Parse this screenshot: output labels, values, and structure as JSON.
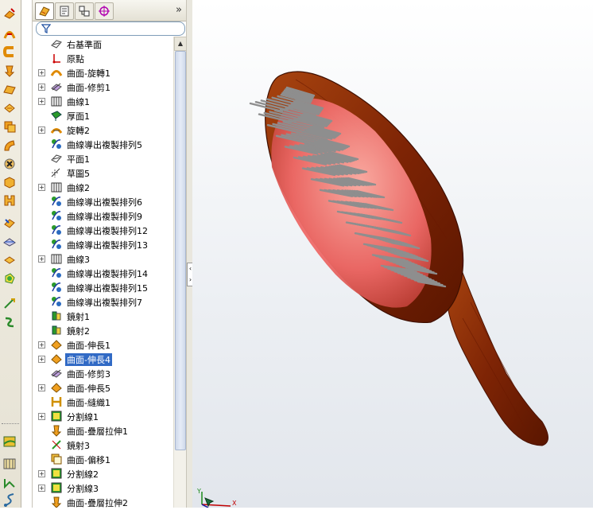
{
  "tabs": [
    {
      "icon": "feature-manager-icon",
      "active": true
    },
    {
      "icon": "property-manager-icon",
      "active": false
    },
    {
      "icon": "configuration-manager-icon",
      "active": false
    },
    {
      "icon": "dimxpert-icon",
      "active": false
    }
  ],
  "collapse_label": "»",
  "tree": [
    {
      "label": "右基準面",
      "icon": "plane-icon",
      "expandable": false
    },
    {
      "label": "原點",
      "icon": "origin-icon",
      "expandable": false
    },
    {
      "label": "曲面-旋轉1",
      "icon": "revolve-surface-icon",
      "expandable": true
    },
    {
      "label": "曲面-修剪1",
      "icon": "trim-surface-icon",
      "expandable": true
    },
    {
      "label": "曲線1",
      "icon": "curve-icon",
      "expandable": true
    },
    {
      "label": "厚面1",
      "icon": "thicken-icon",
      "expandable": false
    },
    {
      "label": "旋轉2",
      "icon": "revolve-icon",
      "expandable": true
    },
    {
      "label": "曲線導出複製排列5",
      "icon": "pattern-icon",
      "expandable": false
    },
    {
      "label": "平面1",
      "icon": "plane-icon",
      "expandable": false
    },
    {
      "label": "草圖5",
      "icon": "sketch-icon",
      "expandable": false
    },
    {
      "label": "曲線2",
      "icon": "curve-icon",
      "expandable": true
    },
    {
      "label": "曲線導出複製排列6",
      "icon": "pattern-icon",
      "expandable": false
    },
    {
      "label": "曲線導出複製排列9",
      "icon": "pattern-icon",
      "expandable": false
    },
    {
      "label": "曲線導出複製排列12",
      "icon": "pattern-icon",
      "expandable": false
    },
    {
      "label": "曲線導出複製排列13",
      "icon": "pattern-icon",
      "expandable": false
    },
    {
      "label": "曲線3",
      "icon": "curve-icon",
      "expandable": true
    },
    {
      "label": "曲線導出複製排列14",
      "icon": "pattern-icon",
      "expandable": false
    },
    {
      "label": "曲線導出複製排列15",
      "icon": "pattern-icon",
      "expandable": false
    },
    {
      "label": "曲線導出複製排列7",
      "icon": "pattern-icon",
      "expandable": false
    },
    {
      "label": "鏡射1",
      "icon": "mirror-icon",
      "expandable": false
    },
    {
      "label": "鏡射2",
      "icon": "mirror-icon",
      "expandable": false
    },
    {
      "label": "曲面-伸長1",
      "icon": "extrude-surface-icon",
      "expandable": true
    },
    {
      "label": "曲面-伸長4",
      "icon": "extrude-surface-icon",
      "expandable": true,
      "selected": true
    },
    {
      "label": "曲面-修剪3",
      "icon": "trim-surface-icon",
      "expandable": false
    },
    {
      "label": "曲面-伸長5",
      "icon": "extrude-surface-icon",
      "expandable": true
    },
    {
      "label": "曲面-縫織1",
      "icon": "knit-surface-icon",
      "expandable": false
    },
    {
      "label": "分割線1",
      "icon": "split-line-icon",
      "expandable": true
    },
    {
      "label": "曲面-疊層拉伸1",
      "icon": "loft-surface-icon",
      "expandable": false
    },
    {
      "label": "鏡射3",
      "icon": "mirror-body-icon",
      "expandable": false
    },
    {
      "label": "曲面-偏移1",
      "icon": "offset-surface-icon",
      "expandable": false
    },
    {
      "label": "分割線2",
      "icon": "split-line-icon",
      "expandable": true
    },
    {
      "label": "分割線3",
      "icon": "split-line-icon",
      "expandable": true
    },
    {
      "label": "曲面-疊層拉伸2",
      "icon": "loft-surface-icon",
      "expandable": false
    }
  ],
  "triad": {
    "y": "Y",
    "x": "X"
  },
  "colors": {
    "selection": "#316ac5",
    "wood": "#8b2a08",
    "cushion": "#e87070",
    "bristle": "#9a9a9a"
  }
}
